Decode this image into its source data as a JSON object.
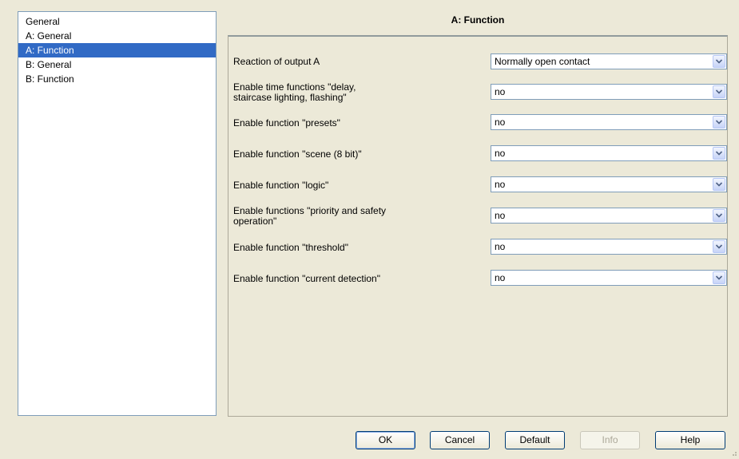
{
  "sidebar": {
    "items": [
      {
        "label": "General"
      },
      {
        "label": "A: General"
      },
      {
        "label": "A: Function",
        "selected": true
      },
      {
        "label": "B: General"
      },
      {
        "label": "B: Function"
      }
    ]
  },
  "page": {
    "title": "A: Function"
  },
  "params": [
    {
      "label": "Reaction of output A",
      "value": "Normally open contact"
    },
    {
      "label": "Enable time functions \"delay,\nstaircase lighting, flashing\"",
      "value": "no"
    },
    {
      "label": "Enable function \"presets\"",
      "value": "no"
    },
    {
      "label": "Enable function \"scene (8 bit)\"",
      "value": "no"
    },
    {
      "label": "Enable function \"logic\"",
      "value": "no"
    },
    {
      "label": "Enable functions \"priority and safety\noperation\"",
      "value": "no"
    },
    {
      "label": "Enable function \"threshold\"",
      "value": "no"
    },
    {
      "label": "Enable function \"current detection\"",
      "value": "no"
    }
  ],
  "buttons": {
    "ok": "OK",
    "cancel": "Cancel",
    "default": "Default",
    "info": "Info",
    "help": "Help"
  },
  "icons": {
    "dropdown": "chevron-down-icon",
    "resize": "resize-grip-icon"
  },
  "colors": {
    "selection": "#316ac5",
    "background": "#ece9d8",
    "border": "#7f9db9"
  }
}
